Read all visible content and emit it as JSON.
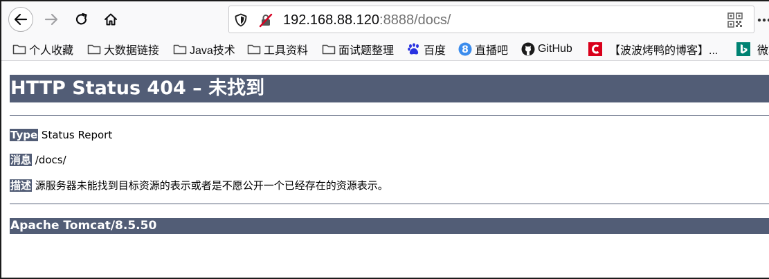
{
  "browser": {
    "url_host": "192.168.88.120",
    "url_rest": ":8888/docs/",
    "icons": {
      "back": "arrow-left-icon",
      "forward": "arrow-right-icon",
      "reload": "reload-icon",
      "home": "home-icon",
      "shield": "shield-icon",
      "insecure": "insecure-lock-icon",
      "qr": "qr-code-icon",
      "overflow": "overflow-icon"
    }
  },
  "bookmarks": [
    {
      "label": "个人收藏",
      "icon": "folder-icon"
    },
    {
      "label": "大数据链接",
      "icon": "folder-icon"
    },
    {
      "label": "Java技术",
      "icon": "folder-icon"
    },
    {
      "label": "工具资料",
      "icon": "folder-icon"
    },
    {
      "label": "面试题整理",
      "icon": "folder-icon"
    },
    {
      "label": "百度",
      "icon": "baidu-icon"
    },
    {
      "label": "直播吧",
      "icon": "zhibo8-icon"
    },
    {
      "label": "GitHub",
      "icon": "github-icon"
    },
    {
      "label": "【波波烤鸭的博客】...",
      "icon": "csdn-icon"
    },
    {
      "label": "微软",
      "icon": "bing-icon"
    }
  ],
  "page": {
    "heading": "HTTP Status 404 – 未找到",
    "type_label": "Type",
    "type_value": "Status Report",
    "message_label": "消息",
    "message_value": "/docs/",
    "description_label": "描述",
    "description_value": "源服务器未能找到目标资源的表示或者是不愿公开一个已经存在的资源表示。",
    "server_info": "Apache Tomcat/8.5.50"
  },
  "colors": {
    "tomcat_bar": "#525d76",
    "toolbar_bg": "#f9f9fa"
  }
}
